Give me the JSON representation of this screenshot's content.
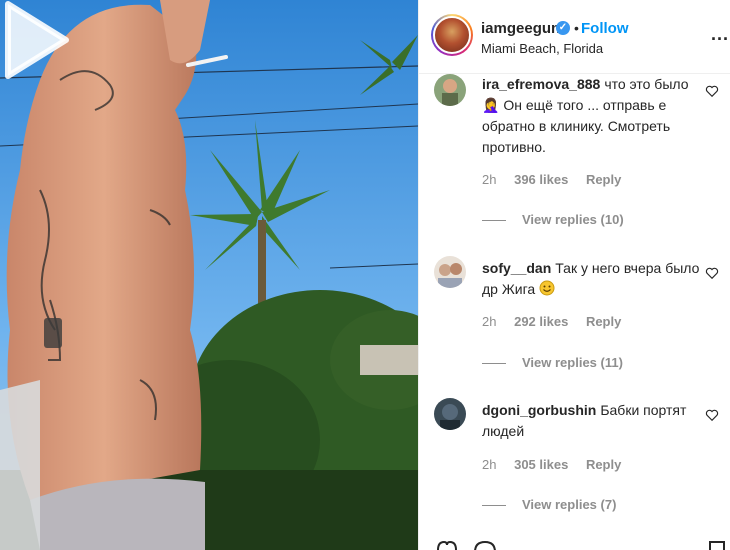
{
  "post": {
    "username": "iamgeegun",
    "verified_icon": "verified-badge-icon",
    "separator": "•",
    "follow_label": "Follow",
    "location": "Miami Beach, Florida",
    "more_label": "..."
  },
  "media": {
    "type": "video",
    "play_icon": "play-icon"
  },
  "comments": [
    {
      "username": "ira_efremova_888",
      "text": "что это было 🤦‍♀️ Он ещё того ... отправь е обратно в клинику. Смотреть противно.",
      "time": "2h",
      "likes": "396 likes",
      "reply": "Reply",
      "view_replies": "View replies (10)"
    },
    {
      "username": "sofy__dan",
      "text": "Так у него вчера было др Жига",
      "time": "2h",
      "likes": "292 likes",
      "reply": "Reply",
      "view_replies": "View replies (11)"
    },
    {
      "username": "dgoni_gorbushin",
      "text": "Бабки портят людей",
      "time": "2h",
      "likes": "305 likes",
      "reply": "Reply",
      "view_replies": "View replies (7)"
    }
  ],
  "colors": {
    "accent": "#0095f6",
    "verified": "#3897f0",
    "muted": "#8e8e8e",
    "text": "#262626"
  }
}
